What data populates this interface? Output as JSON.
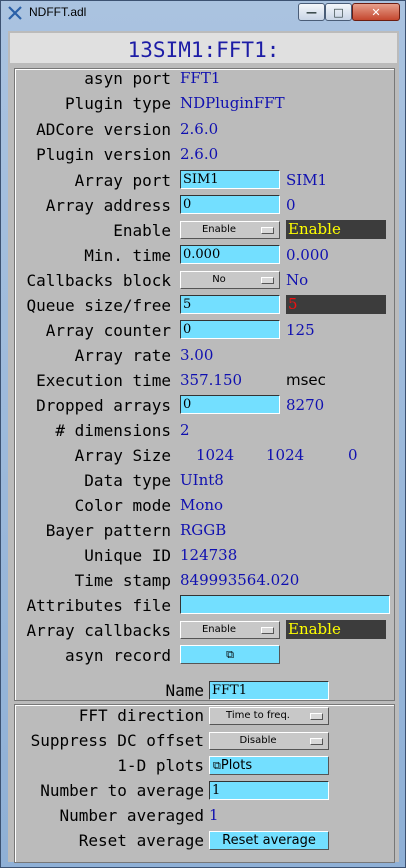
{
  "window": {
    "title": "NDFFT.adl"
  },
  "header": {
    "title": "13SIM1:FFT1:"
  },
  "rows": {
    "asyn_port": {
      "label": "asyn port",
      "value": "FFT1"
    },
    "plugin_type": {
      "label": "Plugin type",
      "value": "NDPluginFFT"
    },
    "adcore_version": {
      "label": "ADCore version",
      "value": "2.6.0"
    },
    "plugin_version": {
      "label": "Plugin version",
      "value": "2.6.0"
    },
    "array_port": {
      "label": "Array port",
      "input": "SIM1",
      "readback": "SIM1"
    },
    "array_address": {
      "label": "Array address",
      "input": "0",
      "readback": "0"
    },
    "enable": {
      "label": "Enable",
      "menu": "Enable",
      "readback": "Enable"
    },
    "min_time": {
      "label": "Min. time",
      "input": "0.000",
      "readback": "0.000"
    },
    "callbacks_block": {
      "label": "Callbacks block",
      "menu": "No",
      "readback": "No"
    },
    "queue_size": {
      "label": "Queue size/free",
      "input": "5",
      "readback": "5"
    },
    "array_counter": {
      "label": "Array counter",
      "input": "0",
      "readback": "125"
    },
    "array_rate": {
      "label": "Array rate",
      "value": "3.00"
    },
    "execution_time": {
      "label": "Execution time",
      "value": "357.150",
      "unit": "msec"
    },
    "dropped_arrays": {
      "label": "Dropped arrays",
      "input": "0",
      "readback": "8270"
    },
    "dimensions": {
      "label": "# dimensions",
      "value": "2"
    },
    "array_size": {
      "label": "Array Size",
      "values": [
        "1024",
        "1024",
        "0"
      ]
    },
    "data_type": {
      "label": "Data type",
      "value": "UInt8"
    },
    "color_mode": {
      "label": "Color mode",
      "value": "Mono"
    },
    "bayer_pattern": {
      "label": "Bayer pattern",
      "value": "RGGB"
    },
    "unique_id": {
      "label": "Unique ID",
      "value": "124738"
    },
    "time_stamp": {
      "label": "Time stamp",
      "value": "849993564.020"
    },
    "attributes_file": {
      "label": "Attributes file",
      "input": ""
    },
    "array_callbacks": {
      "label": "Array callbacks",
      "menu": "Enable",
      "readback": "Enable"
    },
    "asyn_record": {
      "label": "asyn record"
    }
  },
  "fft": {
    "name": {
      "label": "Name",
      "input": "FFT1"
    },
    "direction": {
      "label": "FFT direction",
      "menu": "Time to freq."
    },
    "suppress_dc": {
      "label": "Suppress DC offset",
      "menu": "Disable"
    },
    "plots": {
      "label": "1-D plots",
      "button": "Plots"
    },
    "num_average": {
      "label": "Number to average",
      "input": "1"
    },
    "num_averaged": {
      "label": "Number averaged",
      "value": "1"
    },
    "reset_average": {
      "label": "Reset average",
      "button": "Reset average"
    }
  },
  "icons": {
    "related_display": "two-overlapping-squares-icon"
  },
  "colors": {
    "input_bg": "#73dfff",
    "panel_bg": "#bbbbbb",
    "alarm_box": "#3c3c3c",
    "readback_text": "#1010b0"
  }
}
